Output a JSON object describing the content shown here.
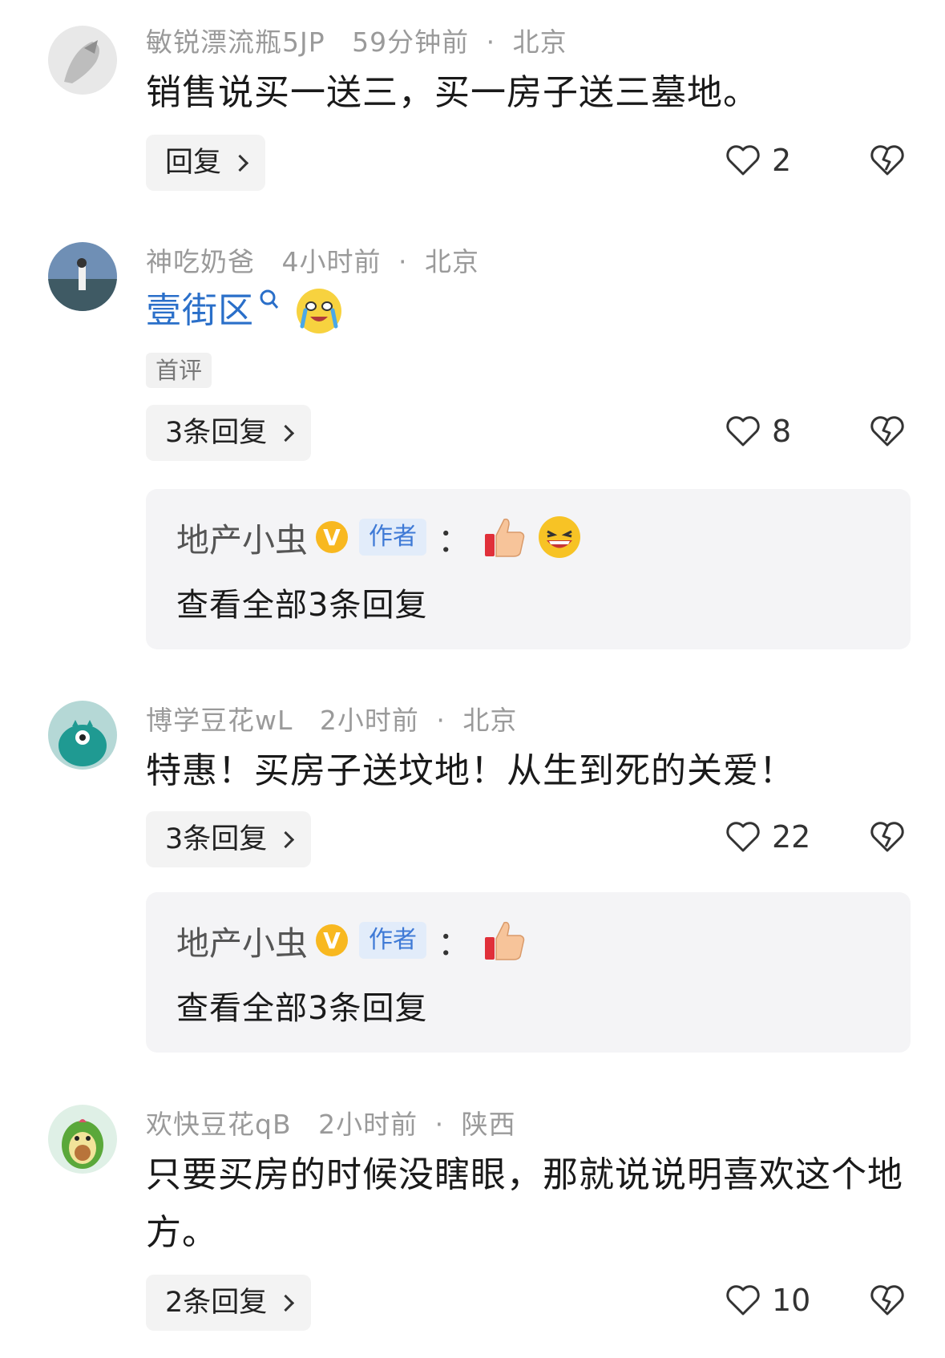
{
  "comments": [
    {
      "user": "敏锐漂流瓶5JP",
      "time": "59分钟前",
      "location": "北京",
      "text": "销售说买一送三，买一房子送三墓地。",
      "reply_label": "回复",
      "likes": "2"
    },
    {
      "user": "神吃奶爸",
      "time": "4小时前",
      "location": "北京",
      "text_link": "壹街区",
      "badge": "首评",
      "reply_label": "3条回复",
      "likes": "8",
      "subreply": {
        "author": "地产小虫",
        "author_tag": "作者",
        "colon": "：",
        "view_all": "查看全部3条回复"
      }
    },
    {
      "user": "博学豆花wL",
      "time": "2小时前",
      "location": "北京",
      "text": "特惠！买房子送坟地！从生到死的关爱！",
      "reply_label": "3条回复",
      "likes": "22",
      "subreply": {
        "author": "地产小虫",
        "author_tag": "作者",
        "colon": "：",
        "view_all": "查看全部3条回复"
      }
    },
    {
      "user": "欢快豆花qB",
      "time": "2小时前",
      "location": "陕西",
      "text": "只要买房的时候没瞎眼，那就说说明喜欢这个地方。",
      "reply_label": "2条回复",
      "likes": "10"
    }
  ],
  "separator": "·",
  "verified_letter": "V"
}
